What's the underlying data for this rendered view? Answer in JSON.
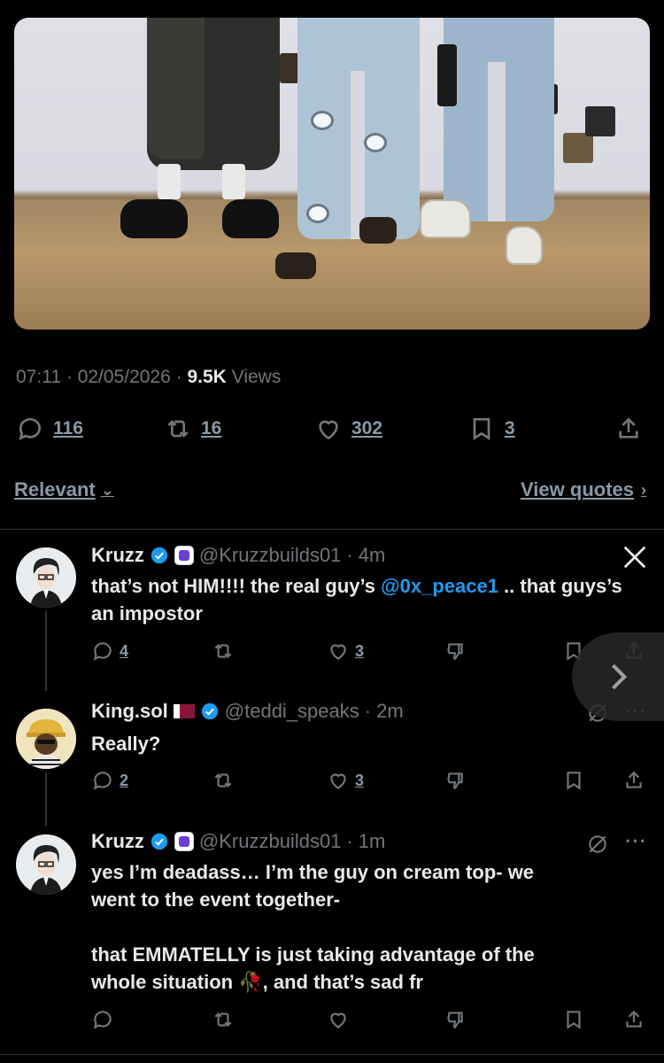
{
  "tweet": {
    "time": "07:11",
    "date": "02/05/2026",
    "views_count": "9.5K",
    "views_label": "Views",
    "sep": "·",
    "actions": {
      "replies": "116",
      "reposts": "16",
      "likes": "302",
      "bookmarks": "3"
    }
  },
  "sort": {
    "label": "Relevant",
    "view_quotes": "View quotes"
  },
  "replies": [
    {
      "name": "Kruzz",
      "handle": "@Kruzzbuilds01",
      "time": "4m",
      "text_before": "that’s not HIM!!!! the real guy’s ",
      "mention": "@0x_peace1",
      "text_after": " .. that guys’s an impostor",
      "replies": "4",
      "likes": "3"
    },
    {
      "name": "King.sol",
      "handle": "@teddi_speaks",
      "time": "2m",
      "text": "Really?",
      "replies": "2",
      "likes": "3"
    },
    {
      "name": "Kruzz",
      "handle": "@Kruzzbuilds01",
      "time": "1m",
      "line1": "yes I’m deadass… I’m the guy on cream top- we",
      "line2": "went to the event together-",
      "line3": "that EMMATELLY is just taking advantage of the",
      "line4a": "whole situation ",
      "emoji": "🥀",
      "line4b": ", and that’s sad fr"
    }
  ],
  "colors": {
    "accent": "#1d9bf0",
    "muted": "#71767b",
    "text": "#e7e9ea",
    "background": "#000000"
  },
  "icons": [
    "reply-icon",
    "repost-icon",
    "like-icon",
    "bookmark-icon",
    "share-icon",
    "x-logo",
    "grok-icon",
    "more-icon",
    "chevron-down-icon",
    "chevron-right-icon",
    "verified-icon",
    "dislike-icon"
  ]
}
